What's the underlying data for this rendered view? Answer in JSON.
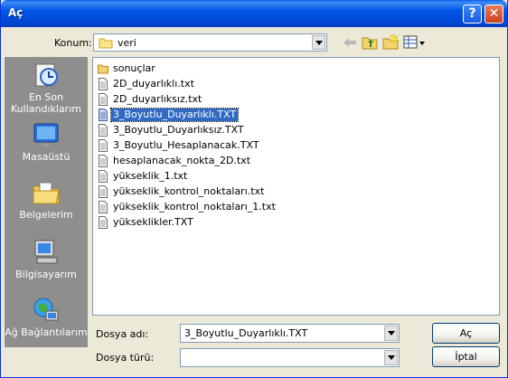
{
  "window": {
    "title": "Aç",
    "help_label": "?",
    "close_label": "✕"
  },
  "location": {
    "label": "Konum:",
    "value": "veri"
  },
  "places": [
    {
      "label": "En Son Kullandıklarım",
      "icon": "recent-documents-icon"
    },
    {
      "label": "Masaüstü",
      "icon": "desktop-icon"
    },
    {
      "label": "Belgelerim",
      "icon": "my-documents-icon"
    },
    {
      "label": "Bilgisayarım",
      "icon": "my-computer-icon"
    },
    {
      "label": "Ağ Bağlantılarım",
      "icon": "network-icon"
    }
  ],
  "files": [
    {
      "name": "sonuçlar",
      "type": "folder"
    },
    {
      "name": "2D_duyarlıklı.txt",
      "type": "txt"
    },
    {
      "name": "2D_duyarlıksız.txt",
      "type": "txt"
    },
    {
      "name": "3_Boyutlu_Duyarlıklı.TXT",
      "type": "txt",
      "selected": true
    },
    {
      "name": "3_Boyutlu_Duyarlıksız.TXT",
      "type": "txt"
    },
    {
      "name": "3_Boyutlu_Hesaplanacak.TXT",
      "type": "txt"
    },
    {
      "name": "hesaplanacak_nokta_2D.txt",
      "type": "txt"
    },
    {
      "name": "yükseklik_1.txt",
      "type": "txt"
    },
    {
      "name": "yükseklik_kontrol_noktaları.txt",
      "type": "txt"
    },
    {
      "name": "yükseklik_kontrol_noktaları_1.txt",
      "type": "txt"
    },
    {
      "name": "yükseklikler.TXT",
      "type": "txt"
    }
  ],
  "filename": {
    "label": "Dosya adı:",
    "value": "3_Boyutlu_Duyarlıklı.TXT"
  },
  "filetype": {
    "label": "Dosya türü:",
    "value": ""
  },
  "buttons": {
    "open": "Aç",
    "cancel": "İptal"
  }
}
